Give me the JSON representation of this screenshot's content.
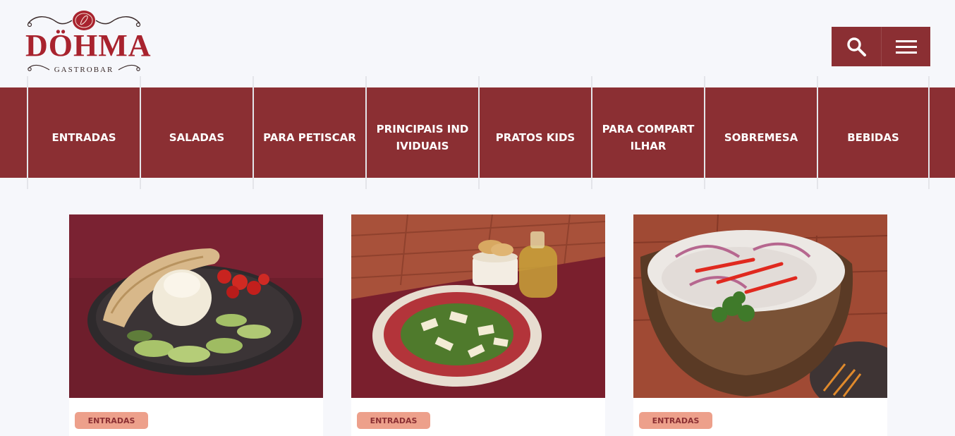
{
  "brand": {
    "name": "DÖHMA",
    "subtitle": "GASTROBAR",
    "color": "#a8232e"
  },
  "header": {
    "search_icon": "search-icon",
    "menu_icon": "hamburger-menu-icon",
    "button_color": "#8b2f33"
  },
  "nav": {
    "items": [
      {
        "label": "ENTRADAS"
      },
      {
        "label": "SALADAS"
      },
      {
        "label": "PARA PETISCAR"
      },
      {
        "label": "PRINCIPAIS INDIVIDUAIS"
      },
      {
        "label": "PRATOS KIDS"
      },
      {
        "label": "PARA COMPARTILHAR"
      },
      {
        "label": "SOBREMESA"
      },
      {
        "label": "BEBIDAS"
      }
    ]
  },
  "cards": [
    {
      "category": "ENTRADAS"
    },
    {
      "category": "ENTRADAS"
    },
    {
      "category": "ENTRADAS"
    }
  ],
  "colors": {
    "accent": "#8b2f33",
    "tag_bg": "#eda08b",
    "page_bg": "#f6f7fb"
  }
}
